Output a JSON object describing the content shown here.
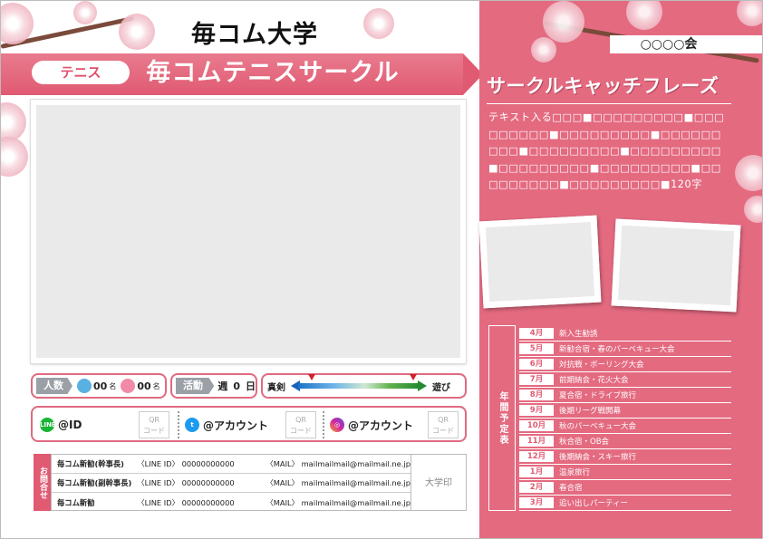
{
  "flyer": {
    "university": "毎コム大学",
    "sport_tag": "テニス",
    "circle_name": "毎コムテニスサークル",
    "club_name": "○○○○会"
  },
  "info": {
    "members_label": "人数",
    "male_count": "00",
    "female_count": "00",
    "count_unit": "名",
    "activity_label": "活動日",
    "activity_prefix": "週",
    "activity_days": "0",
    "activity_unit": "日",
    "scale_left": "真剣",
    "scale_right": "遊び"
  },
  "sns": {
    "line_id": "@ID",
    "twitter_account": "@アカウント",
    "instagram_account": "@アカウント",
    "qr_label_1": "QR",
    "qr_label_2": "コード"
  },
  "contact": {
    "label": "お問合せ",
    "seal": "大学印",
    "rows": [
      {
        "name": "毎コム新勧(幹事長)",
        "line": "〈LINE ID〉 00000000000",
        "mail": "〈MAIL〉 mailmailmail@mailmail.ne.jp"
      },
      {
        "name": "毎コム新勧(副幹事長)",
        "line": "〈LINE ID〉 00000000000",
        "mail": "〈MAIL〉 mailmailmail@mailmail.ne.jp"
      },
      {
        "name": "毎コム新勧",
        "line": "〈LINE ID〉 00000000000",
        "mail": "〈MAIL〉 mailmailmail@mailmail.ne.jp"
      }
    ]
  },
  "catch": {
    "title": "サークルキャッチフレーズ",
    "text": "テキスト入る□□□■□□□□□□□□□■□□□□□□□□□■□□□□□□□□□■□□□□□□□□□■□□□□□□□□□■□□□□□□□□□■□□□□□□□□□■□□□□□□□□□■□□□□□□□□□■□□□□□□□□□■120字"
  },
  "schedule": {
    "label": "年間予定表",
    "items": [
      {
        "month": "4月",
        "event": "新入生勧誘"
      },
      {
        "month": "5月",
        "event": "新勧合宿・春のバーベキュー大会"
      },
      {
        "month": "6月",
        "event": "対抗戦・ボーリング大会"
      },
      {
        "month": "7月",
        "event": "前期納会・花火大会"
      },
      {
        "month": "8月",
        "event": "夏合宿・ドライブ旅行"
      },
      {
        "month": "9月",
        "event": "後期リーグ戦開幕"
      },
      {
        "month": "10月",
        "event": "秋のバーベキュー大会"
      },
      {
        "month": "11月",
        "event": "秋合宿・OB会"
      },
      {
        "month": "12月",
        "event": "後期納会・スキー旅行"
      },
      {
        "month": "1月",
        "event": "温泉旅行"
      },
      {
        "month": "2月",
        "event": "春合宿"
      },
      {
        "month": "3月",
        "event": "追い出しパーティー"
      }
    ]
  },
  "colors": {
    "accent": "#e05a72",
    "panel": "#e46a80"
  },
  "icons": [
    "male-icon",
    "female-icon",
    "line-icon",
    "twitter-icon",
    "instagram-icon",
    "cherry-blossom-icon"
  ]
}
